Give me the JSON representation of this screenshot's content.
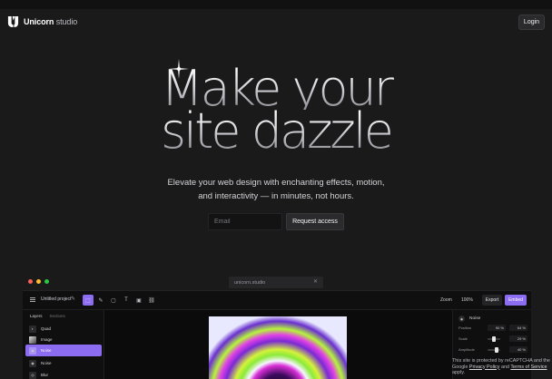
{
  "nav": {
    "brand_bold": "Unicorn",
    "brand_light": "studio",
    "login_label": "Login"
  },
  "hero": {
    "line1": "Make your",
    "line2": "site dazzle",
    "subtitle_line1": "Elevate your web design with enchanting effects, motion,",
    "subtitle_line2": "and interactivity — in minutes, not hours."
  },
  "signup": {
    "email_placeholder": "Email",
    "request_label": "Request access"
  },
  "app": {
    "url": "unicorn.studio",
    "url_close": "✕",
    "window_dots": [
      "#ff5f57",
      "#febc2e",
      "#28c840"
    ],
    "accent": "#8c6cf0",
    "project_name": "Untitled project",
    "zoom_label": "Zoom",
    "zoom_value": "100%",
    "export_label": "Export",
    "embed_label": "Embed",
    "tabs": {
      "layers": "Layers",
      "sections": "Sections"
    },
    "layers": [
      {
        "icon": "gradient-icon",
        "label": "Quad"
      },
      {
        "icon": "image-icon",
        "label": "Image"
      },
      {
        "icon": "noise-icon",
        "label": "Noise",
        "selected": true
      },
      {
        "icon": "noise-icon",
        "label": "Noise"
      },
      {
        "icon": "blur-icon",
        "label": "Blur"
      }
    ],
    "effect": {
      "title": "Noise",
      "props": [
        {
          "label": "Position",
          "v1": "90 %",
          "v2": "64 %"
        },
        {
          "label": "Scale",
          "v1": "29 %"
        },
        {
          "label": "Amplitude",
          "v1": "40 %"
        }
      ]
    }
  },
  "recaptcha": {
    "text1": "This site is protected by reCAPTCHA and the Google",
    "privacy": "Privacy Policy",
    "and": "and",
    "terms": "Terms of Service",
    "apply": "apply."
  }
}
